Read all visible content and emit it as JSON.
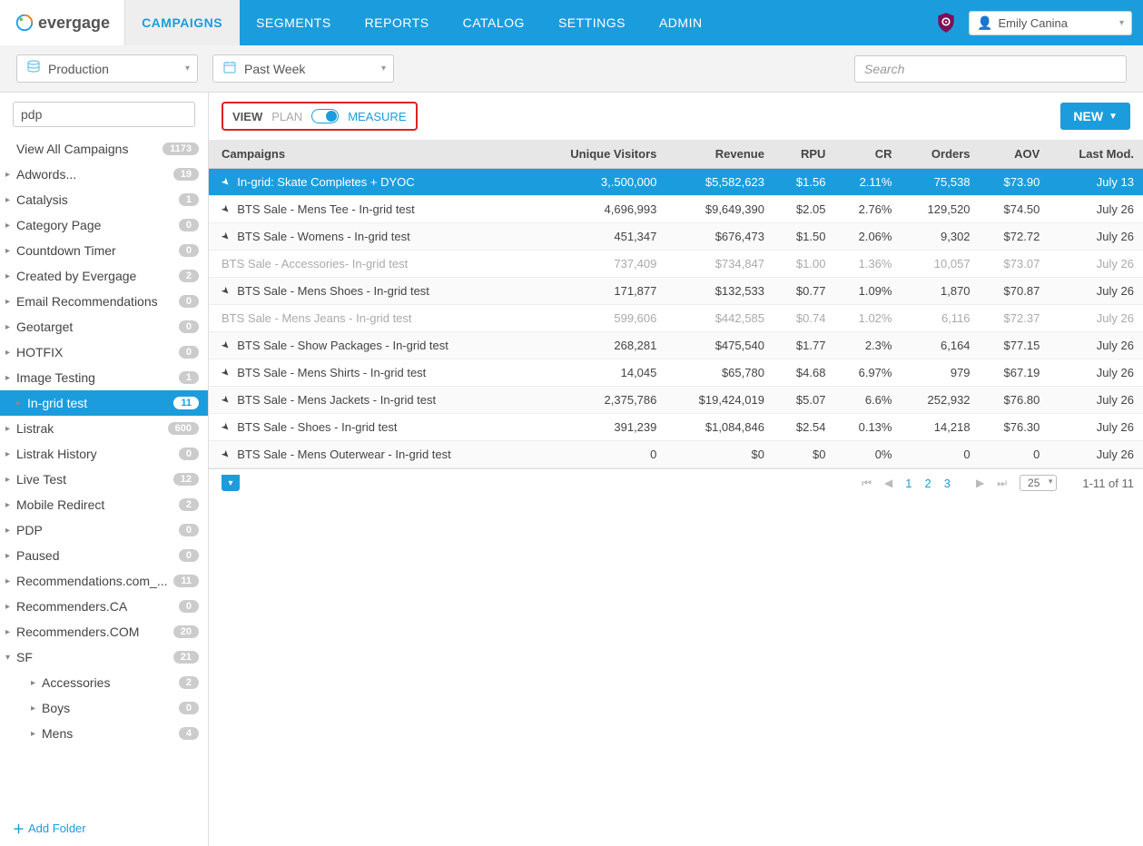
{
  "brand": "evergage",
  "nav": {
    "items": [
      "CAMPAIGNS",
      "SEGMENTS",
      "REPORTS",
      "CATALOG",
      "SETTINGS",
      "ADMIN"
    ],
    "active": "CAMPAIGNS"
  },
  "user": {
    "name": "Emily Canina"
  },
  "subbar": {
    "dataset": "Production",
    "daterange": "Past Week",
    "search_placeholder": "Search"
  },
  "sidebar": {
    "filter_value": "pdp",
    "add_folder": "Add Folder",
    "items": [
      {
        "label": "View All Campaigns",
        "count": "1173",
        "caret": "",
        "indent": 0,
        "active": false
      },
      {
        "label": "Adwords...",
        "count": "19",
        "caret": "▸",
        "indent": 0,
        "active": false
      },
      {
        "label": "Catalysis",
        "count": "1",
        "caret": "▸",
        "indent": 0,
        "active": false
      },
      {
        "label": "Category Page",
        "count": "0",
        "caret": "▸",
        "indent": 0,
        "active": false
      },
      {
        "label": "Countdown Timer",
        "count": "0",
        "caret": "▸",
        "indent": 0,
        "active": false
      },
      {
        "label": "Created by Evergage",
        "count": "2",
        "caret": "▸",
        "indent": 0,
        "active": false
      },
      {
        "label": "Email Recommendations",
        "count": "0",
        "caret": "▸",
        "indent": 0,
        "active": false
      },
      {
        "label": "Geotarget",
        "count": "0",
        "caret": "▸",
        "indent": 0,
        "active": false
      },
      {
        "label": "HOTFIX",
        "count": "0",
        "caret": "▸",
        "indent": 0,
        "active": false
      },
      {
        "label": "Image Testing",
        "count": "1",
        "caret": "▸",
        "indent": 0,
        "active": false
      },
      {
        "label": "In-grid test",
        "count": "11",
        "caret": "▸",
        "indent": 1,
        "active": true
      },
      {
        "label": "Listrak",
        "count": "600",
        "caret": "▸",
        "indent": 0,
        "active": false
      },
      {
        "label": "Listrak History",
        "count": "0",
        "caret": "▸",
        "indent": 0,
        "active": false
      },
      {
        "label": "Live Test",
        "count": "12",
        "caret": "▸",
        "indent": 0,
        "active": false
      },
      {
        "label": "Mobile Redirect",
        "count": "2",
        "caret": "▸",
        "indent": 0,
        "active": false
      },
      {
        "label": "PDP",
        "count": "0",
        "caret": "▸",
        "indent": 0,
        "active": false
      },
      {
        "label": "Paused",
        "count": "0",
        "caret": "▸",
        "indent": 0,
        "active": false
      },
      {
        "label": "Recommendations.com_...",
        "count": "11",
        "caret": "▸",
        "indent": 0,
        "active": false
      },
      {
        "label": "Recommenders.CA",
        "count": "0",
        "caret": "▸",
        "indent": 0,
        "active": false
      },
      {
        "label": "Recommenders.COM",
        "count": "20",
        "caret": "▸",
        "indent": 0,
        "active": false
      },
      {
        "label": "SF",
        "count": "21",
        "caret": "▾",
        "indent": 0,
        "active": false
      },
      {
        "label": "Accessories",
        "count": "2",
        "caret": "▸",
        "indent": 2,
        "active": false
      },
      {
        "label": "Boys",
        "count": "0",
        "caret": "▸",
        "indent": 2,
        "active": false
      },
      {
        "label": "Mens",
        "count": "4",
        "caret": "▸",
        "indent": 2,
        "active": false
      }
    ]
  },
  "viewbar": {
    "view": "VIEW",
    "plan": "PLAN",
    "measure": "MEASURE",
    "new_btn": "NEW"
  },
  "table": {
    "columns": [
      "Campaigns",
      "Unique Visitors",
      "Revenue",
      "RPU",
      "CR",
      "Orders",
      "AOV",
      "Last Mod."
    ],
    "rows": [
      {
        "name": "In-grid: Skate Completes + DYOC",
        "uv": "3,.500,000",
        "rev": "$5,582,623",
        "rpu": "$1.56",
        "cr": "2.11%",
        "orders": "75,538",
        "aov": "$73.90",
        "mod": "July 13",
        "selected": true,
        "dim": false,
        "indent": false
      },
      {
        "name": "BTS Sale - Mens Tee - In-grid test",
        "uv": "4,696,993",
        "rev": "$9,649,390",
        "rpu": "$2.05",
        "cr": "2.76%",
        "orders": "129,520",
        "aov": "$74.50",
        "mod": "July 26",
        "selected": false,
        "dim": false,
        "indent": false
      },
      {
        "name": "BTS Sale - Womens - In-grid test",
        "uv": "451,347",
        "rev": "$676,473",
        "rpu": "$1.50",
        "cr": "2.06%",
        "orders": "9,302",
        "aov": "$72.72",
        "mod": "July 26",
        "selected": false,
        "dim": false,
        "indent": false
      },
      {
        "name": "BTS Sale - Accessories- In-grid test",
        "uv": "737,409",
        "rev": "$734,847",
        "rpu": "$1.00",
        "cr": "1.36%",
        "orders": "10,057",
        "aov": "$73.07",
        "mod": "July 26",
        "selected": false,
        "dim": true,
        "indent": true
      },
      {
        "name": "BTS Sale - Mens Shoes - In-grid test",
        "uv": "171,877",
        "rev": "$132,533",
        "rpu": "$0.77",
        "cr": "1.09%",
        "orders": "1,870",
        "aov": "$70.87",
        "mod": "July 26",
        "selected": false,
        "dim": false,
        "indent": false
      },
      {
        "name": "BTS Sale - Mens Jeans - In-grid test",
        "uv": "599,606",
        "rev": "$442,585",
        "rpu": "$0.74",
        "cr": "1.02%",
        "orders": "6,116",
        "aov": "$72.37",
        "mod": "July 26",
        "selected": false,
        "dim": true,
        "indent": true
      },
      {
        "name": "BTS Sale - Show Packages - In-grid test",
        "uv": "268,281",
        "rev": "$475,540",
        "rpu": "$1.77",
        "cr": "2.3%",
        "orders": "6,164",
        "aov": "$77.15",
        "mod": "July 26",
        "selected": false,
        "dim": false,
        "indent": false
      },
      {
        "name": "BTS Sale - Mens Shirts - In-grid test",
        "uv": "14,045",
        "rev": "$65,780",
        "rpu": "$4.68",
        "cr": "6.97%",
        "orders": "979",
        "aov": "$67.19",
        "mod": "July 26",
        "selected": false,
        "dim": false,
        "indent": false
      },
      {
        "name": "BTS Sale - Mens Jackets - In-grid test",
        "uv": "2,375,786",
        "rev": "$19,424,019",
        "rpu": "$5.07",
        "cr": "6.6%",
        "orders": "252,932",
        "aov": "$76.80",
        "mod": "July 26",
        "selected": false,
        "dim": false,
        "indent": false
      },
      {
        "name": "BTS Sale - Shoes - In-grid test",
        "uv": "391,239",
        "rev": "$1,084,846",
        "rpu": "$2.54",
        "cr": "0.13%",
        "orders": "14,218",
        "aov": "$76.30",
        "mod": "July 26",
        "selected": false,
        "dim": false,
        "indent": false
      },
      {
        "name": "BTS Sale - Mens Outerwear - In-grid test",
        "uv": "0",
        "rev": "$0",
        "rpu": "$0",
        "cr": "0%",
        "orders": "0",
        "aov": "0",
        "mod": "July 26",
        "selected": false,
        "dim": false,
        "indent": false
      }
    ]
  },
  "pager": {
    "pages": [
      "1",
      "2",
      "3"
    ],
    "page_size": "25",
    "range": "1-11 of 11"
  }
}
